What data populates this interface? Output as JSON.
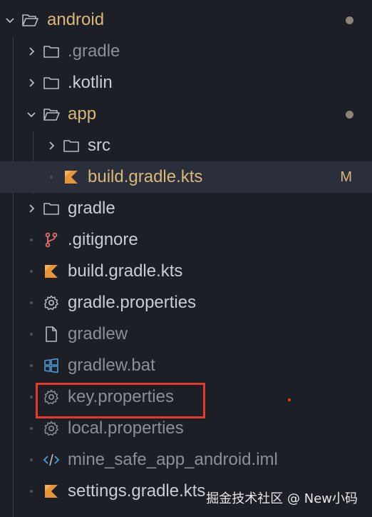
{
  "explorer": {
    "root": {
      "label": "android",
      "status_dot": true
    },
    "items": [
      {
        "label": ".gradle",
        "icon": "folder-icon",
        "kind": "folder-collapsed",
        "depth": 1,
        "dim": true
      },
      {
        "label": ".kotlin",
        "icon": "folder-icon",
        "kind": "folder-collapsed",
        "depth": 1,
        "dim": false
      },
      {
        "label": "app",
        "icon": "folder-open-icon",
        "kind": "folder-expanded",
        "depth": 1,
        "status_dot": true
      },
      {
        "label": "src",
        "icon": "folder-icon",
        "kind": "folder-collapsed",
        "depth": 2
      },
      {
        "label": "build.gradle.kts",
        "icon": "kotlin-icon",
        "kind": "file",
        "depth": 2,
        "badge": "M",
        "selected": true
      },
      {
        "label": "gradle",
        "icon": "folder-icon",
        "kind": "folder-collapsed",
        "depth": 1
      },
      {
        "label": ".gitignore",
        "icon": "git-icon",
        "kind": "file",
        "depth": 1
      },
      {
        "label": "build.gradle.kts",
        "icon": "kotlin-icon",
        "kind": "file",
        "depth": 1
      },
      {
        "label": "gradle.properties",
        "icon": "gear-icon",
        "kind": "file",
        "depth": 1
      },
      {
        "label": "gradlew",
        "icon": "file-icon",
        "kind": "file",
        "depth": 1,
        "dim": true
      },
      {
        "label": "gradlew.bat",
        "icon": "windows-icon",
        "kind": "file",
        "depth": 1,
        "dim": true
      },
      {
        "label": "key.properties",
        "icon": "gear-icon",
        "kind": "file",
        "depth": 1,
        "dim": true,
        "highlighted": true
      },
      {
        "label": "local.properties",
        "icon": "gear-icon",
        "kind": "file",
        "depth": 1,
        "dim": true
      },
      {
        "label": "mine_safe_app_android.iml",
        "icon": "code-icon",
        "kind": "file",
        "depth": 1,
        "dim": true
      },
      {
        "label": "settings.gradle.kts",
        "icon": "kotlin-icon",
        "kind": "file",
        "depth": 1
      }
    ]
  },
  "watermark": "掘金技术社区 @ New小码",
  "colors": {
    "background": "#1c1f26",
    "folder_label": "#c9cdd3",
    "modified": "#d9b77a",
    "highlight_box": "#e53a2a"
  }
}
